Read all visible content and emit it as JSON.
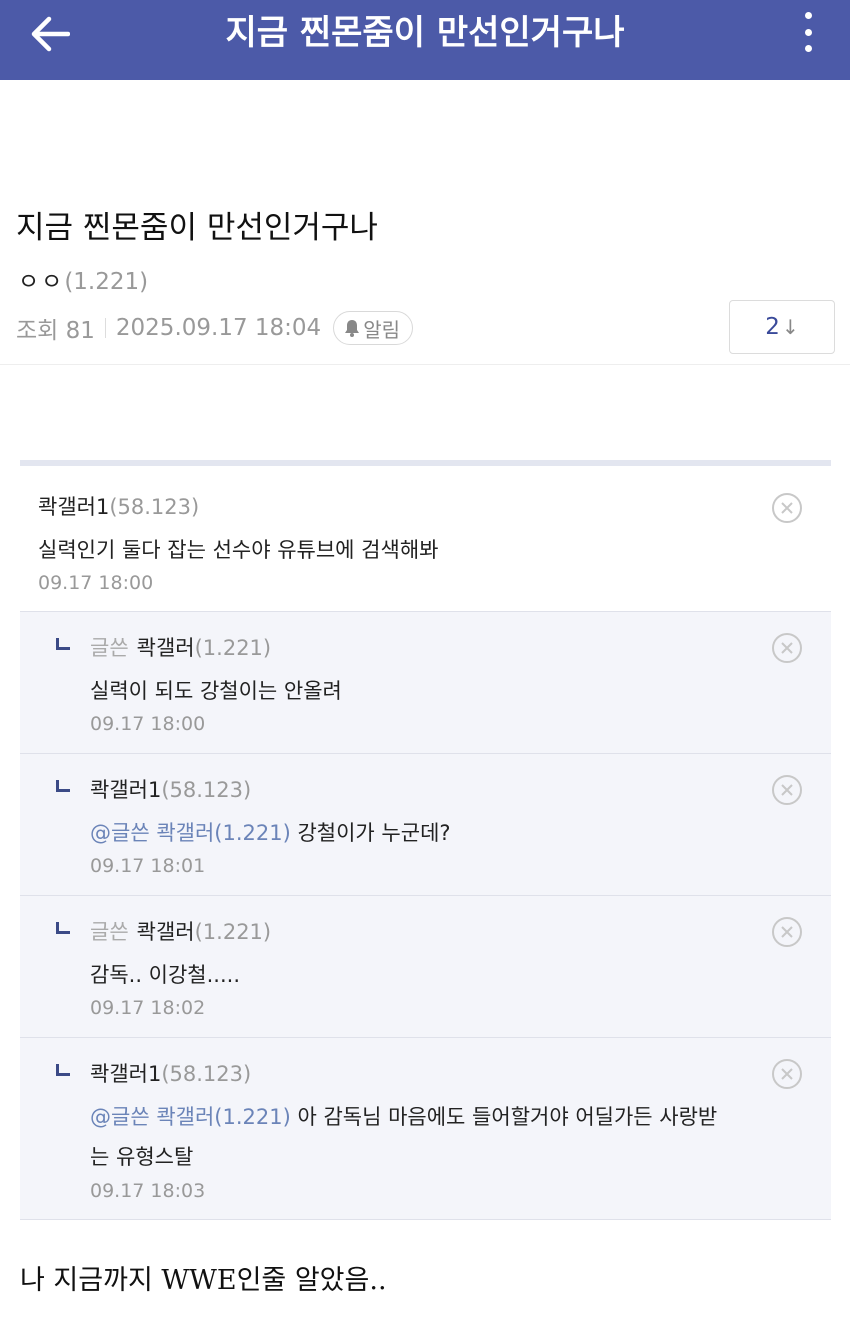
{
  "topbar": {
    "title": "지금 찐몬줌이 만선인거구나",
    "back_icon": "arrow-left-icon",
    "more_icon": "more-vertical-icon",
    "color": "#4c5aa8"
  },
  "post": {
    "title": "지금 찐몬줌이 만선인거구나",
    "author_nick": "ㅇㅇ",
    "author_ip": "(1.221)",
    "views_label": "조회 81",
    "date": "2025.09.17 18:04",
    "alarm_label": "알림",
    "comment_count": "2",
    "comment_arrow": "↓"
  },
  "comments": [
    {
      "nick": "콱갤러1",
      "ip": "(58.123)",
      "text": "실력인기 둘다 잡는 선수야 유튜브에 검색해봐",
      "time": "09.17 18:00"
    }
  ],
  "replies": [
    {
      "writer_tag": "글쓴",
      "nick": "콱갤러",
      "ip": "(1.221)",
      "mention": "",
      "text": "실력이 되도 강철이는 안올려",
      "time": "09.17 18:00"
    },
    {
      "writer_tag": "",
      "nick": "콱갤러1",
      "ip": "(58.123)",
      "mention": "@글쓴 콱갤러(1.221)",
      "text": "강철이가 누군데?",
      "time": "09.17 18:01"
    },
    {
      "writer_tag": "글쓴",
      "nick": "콱갤러",
      "ip": "(1.221)",
      "mention": "",
      "text": "감독.. 이강철.....",
      "time": "09.17 18:02"
    },
    {
      "writer_tag": "",
      "nick": "콱갤러1",
      "ip": "(58.123)",
      "mention": "@글쓴 콱갤러(1.221)",
      "text": "아 감독님 마음에도 들어할거야 어딜가든 사랑받",
      "text2": "는 유형스탈",
      "time": "09.17 18:03"
    }
  ],
  "footer": {
    "text": "나 지금까지 WWE인줄 알았음.."
  }
}
